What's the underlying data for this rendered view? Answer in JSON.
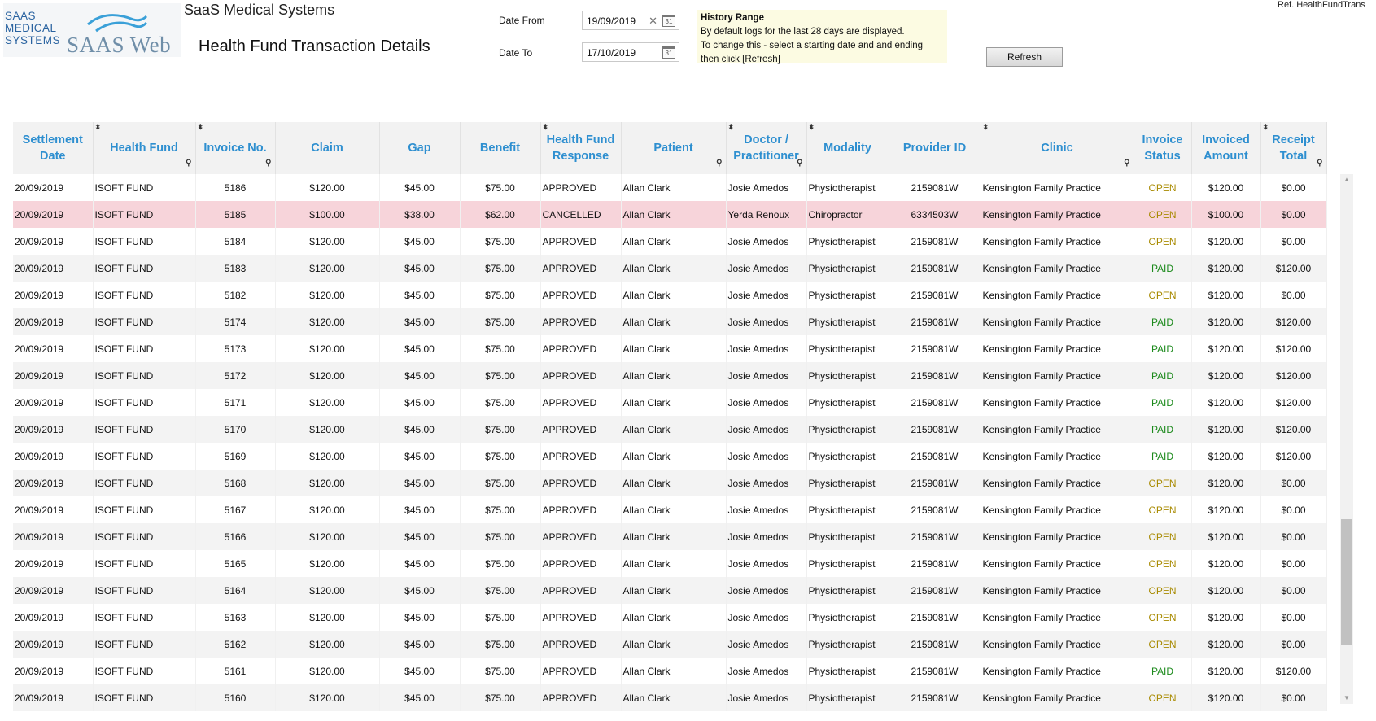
{
  "logo": {
    "small_lines": [
      "SAAS",
      "MEDICAL",
      "SYSTEMS"
    ],
    "big_text": "SAAS Web"
  },
  "app_title": "SaaS Medical Systems",
  "page_title": "Health Fund Transaction Details",
  "ref": "Ref. HealthFundTrans",
  "date_from": {
    "label": "Date From",
    "value": "19/09/2019"
  },
  "date_to": {
    "label": "Date To",
    "value": "17/10/2019"
  },
  "history": {
    "title": "History Range",
    "line1": "By default logs for the last 28 days are displayed.",
    "line2": "To change this - select a starting date and and ending",
    "line3": "then click [Refresh]"
  },
  "refresh_label": "Refresh",
  "colors": {
    "header_text": "#2e8fd0",
    "open": "#a88a00",
    "paid": "#1c8a1c",
    "cancelled_row": "#f7d4da"
  },
  "columns": [
    {
      "l1": "Settlement",
      "l2": "Date"
    },
    {
      "l1": "Health Fund",
      "l2": ""
    },
    {
      "l1": "Invoice No.",
      "l2": ""
    },
    {
      "l1": "Claim",
      "l2": ""
    },
    {
      "l1": "Gap",
      "l2": ""
    },
    {
      "l1": "Benefit",
      "l2": ""
    },
    {
      "l1": "Health Fund",
      "l2": "Response"
    },
    {
      "l1": "Patient",
      "l2": ""
    },
    {
      "l1": "Doctor /",
      "l2": "Practitioner"
    },
    {
      "l1": "Modality",
      "l2": ""
    },
    {
      "l1": "Provider ID",
      "l2": ""
    },
    {
      "l1": "Clinic",
      "l2": ""
    },
    {
      "l1": "Invoice",
      "l2": "Status"
    },
    {
      "l1": "Invoiced",
      "l2": "Amount"
    },
    {
      "l1": "Receipt",
      "l2": "Total"
    }
  ],
  "rows": [
    [
      "20/09/2019",
      "ISOFT FUND",
      "5186",
      "$120.00",
      "$45.00",
      "$75.00",
      "APPROVED",
      "Allan Clark",
      "Josie Amedos",
      "Physiotherapist",
      "2159081W",
      "Kensington Family Practice",
      "OPEN",
      "$120.00",
      "$0.00"
    ],
    [
      "20/09/2019",
      "ISOFT FUND",
      "5185",
      "$100.00",
      "$38.00",
      "$62.00",
      "CANCELLED",
      "Allan Clark",
      "Yerda Renoux",
      "Chiropractor",
      "6334503W",
      "Kensington Family Practice",
      "OPEN",
      "$100.00",
      "$0.00"
    ],
    [
      "20/09/2019",
      "ISOFT FUND",
      "5184",
      "$120.00",
      "$45.00",
      "$75.00",
      "APPROVED",
      "Allan Clark",
      "Josie Amedos",
      "Physiotherapist",
      "2159081W",
      "Kensington Family Practice",
      "OPEN",
      "$120.00",
      "$0.00"
    ],
    [
      "20/09/2019",
      "ISOFT FUND",
      "5183",
      "$120.00",
      "$45.00",
      "$75.00",
      "APPROVED",
      "Allan Clark",
      "Josie Amedos",
      "Physiotherapist",
      "2159081W",
      "Kensington Family Practice",
      "PAID",
      "$120.00",
      "$120.00"
    ],
    [
      "20/09/2019",
      "ISOFT FUND",
      "5182",
      "$120.00",
      "$45.00",
      "$75.00",
      "APPROVED",
      "Allan Clark",
      "Josie Amedos",
      "Physiotherapist",
      "2159081W",
      "Kensington Family Practice",
      "OPEN",
      "$120.00",
      "$0.00"
    ],
    [
      "20/09/2019",
      "ISOFT FUND",
      "5174",
      "$120.00",
      "$45.00",
      "$75.00",
      "APPROVED",
      "Allan Clark",
      "Josie Amedos",
      "Physiotherapist",
      "2159081W",
      "Kensington Family Practice",
      "PAID",
      "$120.00",
      "$120.00"
    ],
    [
      "20/09/2019",
      "ISOFT FUND",
      "5173",
      "$120.00",
      "$45.00",
      "$75.00",
      "APPROVED",
      "Allan Clark",
      "Josie Amedos",
      "Physiotherapist",
      "2159081W",
      "Kensington Family Practice",
      "PAID",
      "$120.00",
      "$120.00"
    ],
    [
      "20/09/2019",
      "ISOFT FUND",
      "5172",
      "$120.00",
      "$45.00",
      "$75.00",
      "APPROVED",
      "Allan Clark",
      "Josie Amedos",
      "Physiotherapist",
      "2159081W",
      "Kensington Family Practice",
      "PAID",
      "$120.00",
      "$120.00"
    ],
    [
      "20/09/2019",
      "ISOFT FUND",
      "5171",
      "$120.00",
      "$45.00",
      "$75.00",
      "APPROVED",
      "Allan Clark",
      "Josie Amedos",
      "Physiotherapist",
      "2159081W",
      "Kensington Family Practice",
      "PAID",
      "$120.00",
      "$120.00"
    ],
    [
      "20/09/2019",
      "ISOFT FUND",
      "5170",
      "$120.00",
      "$45.00",
      "$75.00",
      "APPROVED",
      "Allan Clark",
      "Josie Amedos",
      "Physiotherapist",
      "2159081W",
      "Kensington Family Practice",
      "PAID",
      "$120.00",
      "$120.00"
    ],
    [
      "20/09/2019",
      "ISOFT FUND",
      "5169",
      "$120.00",
      "$45.00",
      "$75.00",
      "APPROVED",
      "Allan Clark",
      "Josie Amedos",
      "Physiotherapist",
      "2159081W",
      "Kensington Family Practice",
      "PAID",
      "$120.00",
      "$120.00"
    ],
    [
      "20/09/2019",
      "ISOFT FUND",
      "5168",
      "$120.00",
      "$45.00",
      "$75.00",
      "APPROVED",
      "Allan Clark",
      "Josie Amedos",
      "Physiotherapist",
      "2159081W",
      "Kensington Family Practice",
      "OPEN",
      "$120.00",
      "$0.00"
    ],
    [
      "20/09/2019",
      "ISOFT FUND",
      "5167",
      "$120.00",
      "$45.00",
      "$75.00",
      "APPROVED",
      "Allan Clark",
      "Josie Amedos",
      "Physiotherapist",
      "2159081W",
      "Kensington Family Practice",
      "OPEN",
      "$120.00",
      "$0.00"
    ],
    [
      "20/09/2019",
      "ISOFT FUND",
      "5166",
      "$120.00",
      "$45.00",
      "$75.00",
      "APPROVED",
      "Allan Clark",
      "Josie Amedos",
      "Physiotherapist",
      "2159081W",
      "Kensington Family Practice",
      "OPEN",
      "$120.00",
      "$0.00"
    ],
    [
      "20/09/2019",
      "ISOFT FUND",
      "5165",
      "$120.00",
      "$45.00",
      "$75.00",
      "APPROVED",
      "Allan Clark",
      "Josie Amedos",
      "Physiotherapist",
      "2159081W",
      "Kensington Family Practice",
      "OPEN",
      "$120.00",
      "$0.00"
    ],
    [
      "20/09/2019",
      "ISOFT FUND",
      "5164",
      "$120.00",
      "$45.00",
      "$75.00",
      "APPROVED",
      "Allan Clark",
      "Josie Amedos",
      "Physiotherapist",
      "2159081W",
      "Kensington Family Practice",
      "OPEN",
      "$120.00",
      "$0.00"
    ],
    [
      "20/09/2019",
      "ISOFT FUND",
      "5163",
      "$120.00",
      "$45.00",
      "$75.00",
      "APPROVED",
      "Allan Clark",
      "Josie Amedos",
      "Physiotherapist",
      "2159081W",
      "Kensington Family Practice",
      "OPEN",
      "$120.00",
      "$0.00"
    ],
    [
      "20/09/2019",
      "ISOFT FUND",
      "5162",
      "$120.00",
      "$45.00",
      "$75.00",
      "APPROVED",
      "Allan Clark",
      "Josie Amedos",
      "Physiotherapist",
      "2159081W",
      "Kensington Family Practice",
      "OPEN",
      "$120.00",
      "$0.00"
    ],
    [
      "20/09/2019",
      "ISOFT FUND",
      "5161",
      "$120.00",
      "$45.00",
      "$75.00",
      "APPROVED",
      "Allan Clark",
      "Josie Amedos",
      "Physiotherapist",
      "2159081W",
      "Kensington Family Practice",
      "PAID",
      "$120.00",
      "$120.00"
    ],
    [
      "20/09/2019",
      "ISOFT FUND",
      "5160",
      "$120.00",
      "$45.00",
      "$75.00",
      "APPROVED",
      "Allan Clark",
      "Josie Amedos",
      "Physiotherapist",
      "2159081W",
      "Kensington Family Practice",
      "OPEN",
      "$120.00",
      "$0.00"
    ]
  ]
}
